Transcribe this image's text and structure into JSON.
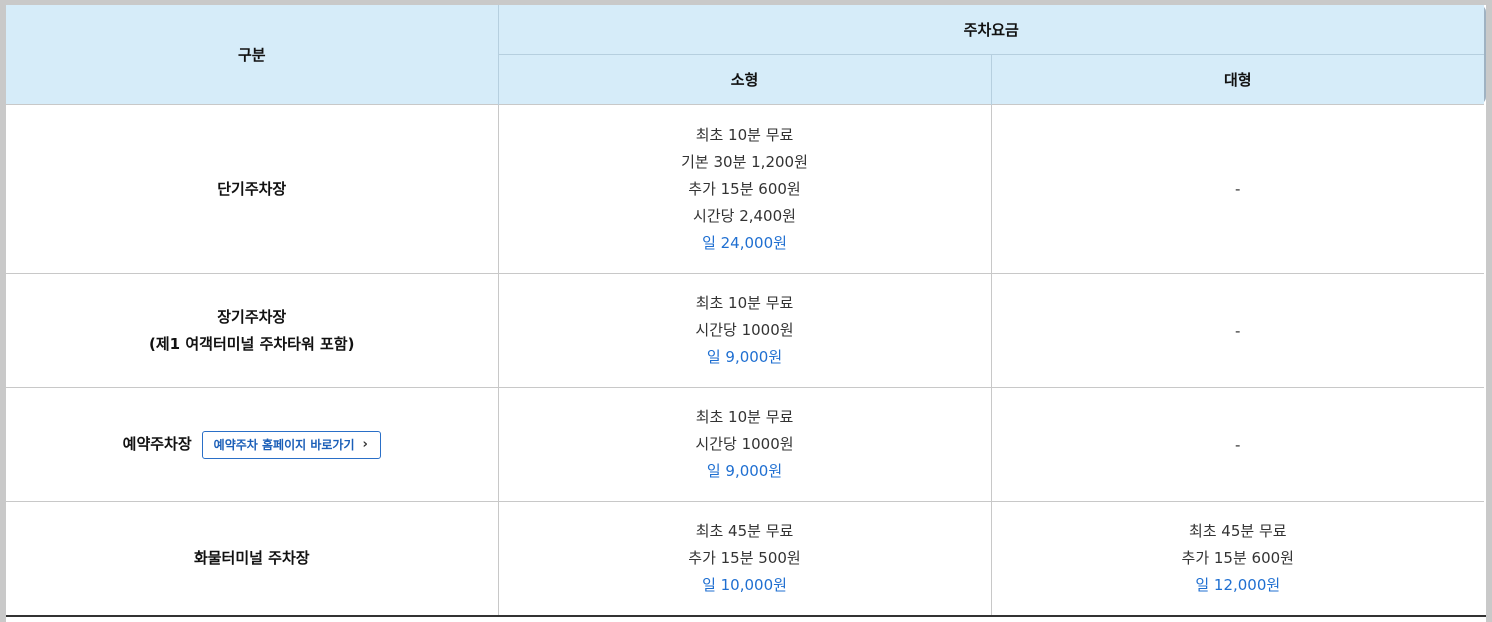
{
  "table": {
    "headers": {
      "category": "구분",
      "fee_group": "주차요금",
      "small": "소형",
      "large": "대형"
    },
    "rows": [
      {
        "label_lines": [
          "단기주차장"
        ],
        "small": [
          "최초 10분 무료",
          "기본 30분 1,200원",
          "추가 15분 600원",
          "시간당 2,400원"
        ],
        "small_daily": "일 24,000원",
        "large": [],
        "large_daily": "",
        "large_dash": "-"
      },
      {
        "label_lines": [
          "장기주차장",
          "(제1 여객터미널 주차타워 포함)"
        ],
        "small": [
          "최초 10분 무료",
          "시간당 1000원"
        ],
        "small_daily": "일 9,000원",
        "large": [],
        "large_daily": "",
        "large_dash": "-"
      },
      {
        "label_lines": [
          "예약주차장"
        ],
        "link_label": "예약주차 홈페이지 바로가기",
        "link_icon": "chevron-right-icon",
        "chevron_glyph": "›",
        "small": [
          "최초 10분 무료",
          "시간당 1000원"
        ],
        "small_daily": "일 9,000원",
        "large": [],
        "large_daily": "",
        "large_dash": "-"
      },
      {
        "label_lines": [
          "화물터미널 주차장"
        ],
        "small": [
          "최초 45분 무료",
          "추가 15분 500원"
        ],
        "small_daily": "일 10,000원",
        "large": [
          "최초 45분 무료",
          "추가 15분 600원"
        ],
        "large_daily": "일 12,000원",
        "large_dash": ""
      }
    ]
  },
  "colors": {
    "header_bg": "#d6ecf9",
    "daily_fee": "#1f6fd1",
    "link_border": "#2a6fc7"
  }
}
